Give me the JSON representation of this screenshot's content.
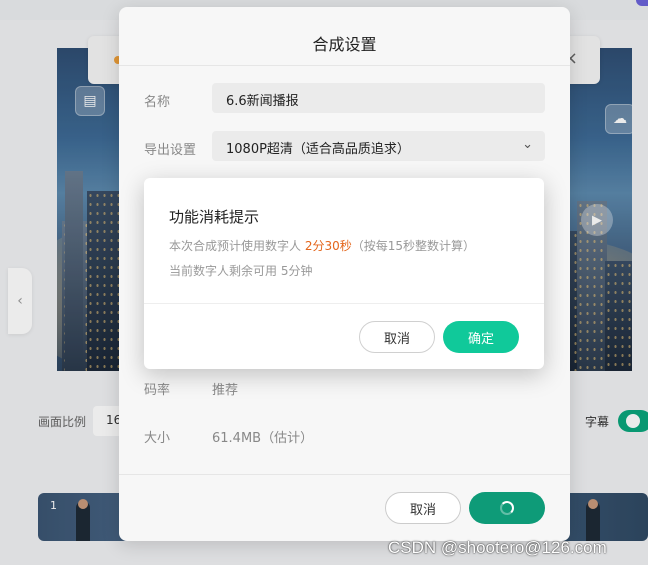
{
  "background": {
    "toast_close": "×",
    "side_arrow": "‹",
    "ratio_label": "画面比例",
    "ratio_value": "16",
    "subtitle_label": "字幕",
    "subtitle_toggle_on": true,
    "timeline_index": "1",
    "accent_color": "#0aa57c"
  },
  "settings_modal": {
    "title": "合成设置",
    "name_label": "名称",
    "name_value": "6.6新闻播报",
    "export_label": "导出设置",
    "export_value": "1080P超清（适合高品质追求）",
    "bitrate_label": "码率",
    "bitrate_value": "推荐",
    "size_label": "大小",
    "size_value": "61.4MB（估计）",
    "cancel_label": "取消",
    "confirm_loading": true
  },
  "alert_modal": {
    "title": "功能消耗提示",
    "line1_prefix": "本次合成预计使用数字人 ",
    "line1_highlight": "2分30秒",
    "line1_suffix": "（按每15秒整数计算）",
    "line2": "当前数字人剩余可用 5分钟",
    "cancel_label": "取消",
    "confirm_label": "确定",
    "highlight_color": "#e4661c",
    "confirm_color": "#10c99a"
  },
  "watermark": "CSDN @shootero@126.com"
}
